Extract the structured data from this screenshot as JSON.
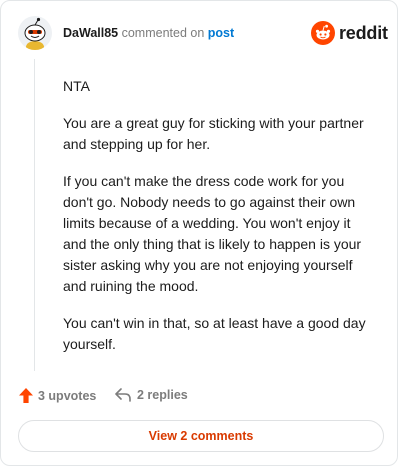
{
  "comment": {
    "username": "DaWall85",
    "action_text": "commented on",
    "target_link": "post",
    "body": [
      "NTA",
      "You are a great guy for sticking with your partner and stepping up for her.",
      "If you can't make the dress code work for you don't go. Nobody needs to go against their own limits because of a wedding. You won't enjoy it and the only thing that is likely to happen is your sister asking why you are not enjoying yourself and ruining the mood.",
      "You can't win in that, so at least have a good day yourself."
    ]
  },
  "brand": {
    "name": "reddit",
    "color": "#ff4500"
  },
  "actions": {
    "upvotes_label": "3 upvotes",
    "replies_label": "2 replies",
    "upvote_color": "#ff4500"
  },
  "footer": {
    "view_comments_label": "View 2 comments",
    "button_text_color": "#d93a00"
  }
}
